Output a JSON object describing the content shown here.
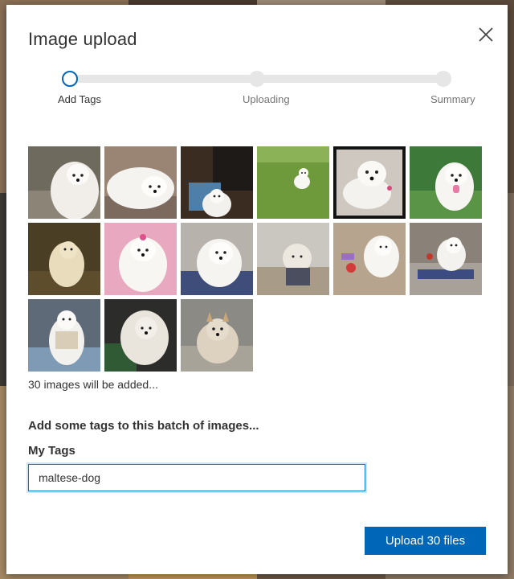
{
  "dialog": {
    "title": "Image upload",
    "close_icon": "close-icon"
  },
  "stepper": {
    "steps": [
      {
        "label": "Add Tags",
        "state": "active"
      },
      {
        "label": "Uploading",
        "state": "pending"
      },
      {
        "label": "Summary",
        "state": "pending"
      }
    ],
    "accent": "#0067b8"
  },
  "thumbnails": {
    "count_shown": 15,
    "selected_index": 4
  },
  "status": {
    "count_text": "30 images will be added..."
  },
  "tags": {
    "prompt": "Add some tags to this batch of images...",
    "label": "My Tags",
    "value": "maltese-dog"
  },
  "actions": {
    "upload_label": "Upload 30 files",
    "button_color": "#0067b8"
  }
}
